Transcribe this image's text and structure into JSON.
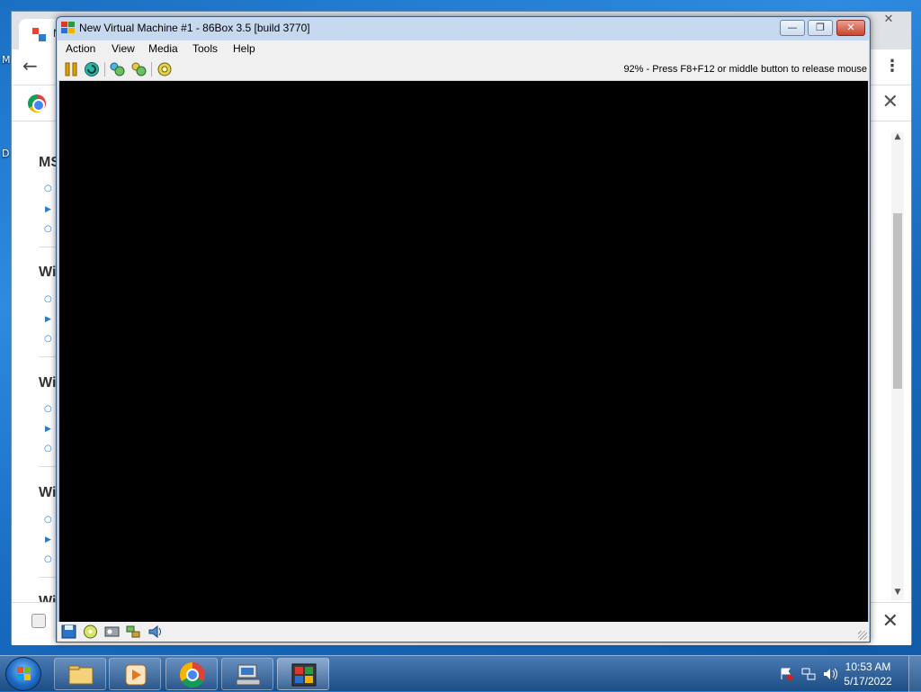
{
  "desktop": {
    "left_labels": [
      "M",
      "D"
    ]
  },
  "chrome": {
    "tab_title": "N",
    "minimize_glyph": "—",
    "close_glyph": "✕",
    "back_glyph": "←",
    "menu_glyph": "⋮",
    "infobar_close_glyph": "✕",
    "bottom_close_glyph": "✕",
    "scroll_up_glyph": "▲",
    "scroll_down_glyph": "▼",
    "page": {
      "headings": [
        "MS",
        "Wi",
        "Wi",
        "Wi",
        "Wi"
      ],
      "bullet_glyph": "○",
      "tri_glyph": "▶"
    }
  },
  "vm": {
    "title": "New Virtual Machine #1 - 86Box 3.5 [build 3770]",
    "minimize_glyph": "—",
    "restore_glyph": "❐",
    "close_glyph": "✕",
    "menu": [
      "Action",
      "View",
      "Media",
      "Tools",
      "Help"
    ],
    "toolbar_buttons": [
      "pause-icon",
      "hard-reset-icon",
      "ctrl-alt-del-icon",
      "ctrl-alt-esc-icon",
      "settings-icon"
    ],
    "status_text": "92% - Press F8+F12 or middle button to release mouse",
    "statusbar_icons": [
      "floppy-icon",
      "cdrom-icon",
      "hdd-icon",
      "network-icon",
      "sound-icon"
    ]
  },
  "taskbar": {
    "tasks": [
      "explorer-icon",
      "media-player-icon",
      "chrome-icon",
      "computer-icon",
      "86box-icon"
    ],
    "tray_icons": [
      "action-center-icon",
      "network-tray-icon",
      "volume-icon"
    ],
    "time": "10:53 AM",
    "date": "5/17/2022"
  },
  "colors": {
    "vm_screen": "#000000",
    "title_gradient_top": "#c6d9ef",
    "taskbar": "#1d4d85"
  }
}
